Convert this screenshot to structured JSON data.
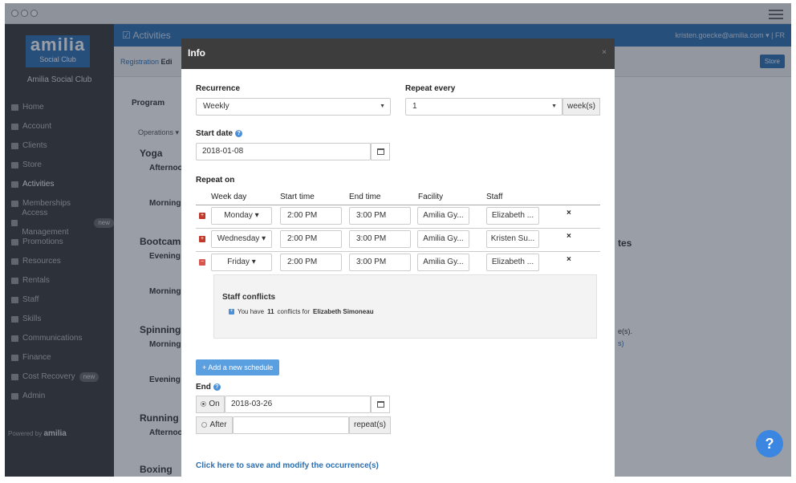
{
  "app": {
    "window_dots": 3
  },
  "sidebar": {
    "logo_text": "amilia",
    "logo_sub": "Social Club",
    "club_name": "Amilia Social Club",
    "items": [
      {
        "label": "Home",
        "icon": "home-icon"
      },
      {
        "label": "Account",
        "icon": "bank-icon"
      },
      {
        "label": "Clients",
        "icon": "users-icon"
      },
      {
        "label": "Store",
        "icon": "cart-icon"
      },
      {
        "label": "Activities",
        "icon": "check-square-icon"
      },
      {
        "label": "Memberships",
        "icon": "card-icon"
      },
      {
        "label": "Access Management",
        "icon": "arrows-icon",
        "badge": "new"
      },
      {
        "label": "Promotions",
        "icon": "dollar-icon"
      },
      {
        "label": "Resources",
        "icon": "building-icon"
      },
      {
        "label": "Rentals",
        "icon": "file-icon"
      },
      {
        "label": "Staff",
        "icon": "id-icon"
      },
      {
        "label": "Skills",
        "icon": "graduation-icon"
      },
      {
        "label": "Communications",
        "icon": "envelope-icon"
      },
      {
        "label": "Finance",
        "icon": "chart-icon"
      },
      {
        "label": "Cost Recovery",
        "icon": "dollar-icon",
        "badge": "new"
      },
      {
        "label": "Admin",
        "icon": "lock-icon"
      }
    ],
    "powered_by": "Powered by",
    "powered_brand": "amilia"
  },
  "topbar": {
    "title": "Activities",
    "user": "kristen.goecke@amilia.com ▾ | FR"
  },
  "subbar": {
    "registration": "Registration",
    "edit": "Edi",
    "store": "Store"
  },
  "background": {
    "program_label": "Program",
    "operations": "Operations ▾",
    "groups": [
      "Yoga",
      "Bootcamp",
      "Spinning",
      "Running",
      "Boxing"
    ],
    "subs": [
      "Afternoo",
      "Morning",
      "Evening",
      "Morning",
      "Morning",
      "Evening",
      "Afternoo"
    ],
    "right_heading": "tes",
    "right_text": "e(s).",
    "right_link": "s)"
  },
  "modal": {
    "title": "Info",
    "close": "×",
    "recurrence_label": "Recurrence",
    "recurrence_value": "Weekly",
    "repeat_every_label": "Repeat every",
    "repeat_every_value": "1",
    "repeat_every_unit": "week(s)",
    "start_date_label": "Start date",
    "start_date_value": "2018-01-08",
    "repeat_on_label": "Repeat on",
    "columns": [
      "Week day",
      "Start time",
      "End time",
      "Facility",
      "Staff"
    ],
    "rows": [
      {
        "day": "Monday",
        "start": "2:00 PM",
        "end": "3:00 PM",
        "facility": "Amilia Gy...",
        "staff": "Elizabeth ...",
        "status": "conflict"
      },
      {
        "day": "Wednesday",
        "start": "2:00 PM",
        "end": "3:00 PM",
        "facility": "Amilia Gy...",
        "staff": "Kristen Su...",
        "status": "conflict"
      },
      {
        "day": "Friday",
        "start": "2:00 PM",
        "end": "3:00 PM",
        "facility": "Amilia Gy...",
        "staff": "Elizabeth ...",
        "status": "expanded"
      }
    ],
    "conflicts": {
      "title": "Staff conflicts",
      "prefix": "You have",
      "count": "11",
      "middle": "conflicts for",
      "name": "Elizabeth Simoneau"
    },
    "add_schedule": "+ Add a new schedule",
    "end_label": "End",
    "end_on_label": "On",
    "end_on_value": "2018-03-26",
    "end_after_label": "After",
    "end_after_value": "",
    "end_after_unit": "repeat(s)",
    "save_link": "Click here to save and modify the occurrence(s)"
  },
  "help_fab": "?",
  "colors": {
    "brand": "#2d6fb0",
    "sidebar": "#3a3a3a",
    "conflict": "#c0392b",
    "accent": "#3a86e0"
  }
}
